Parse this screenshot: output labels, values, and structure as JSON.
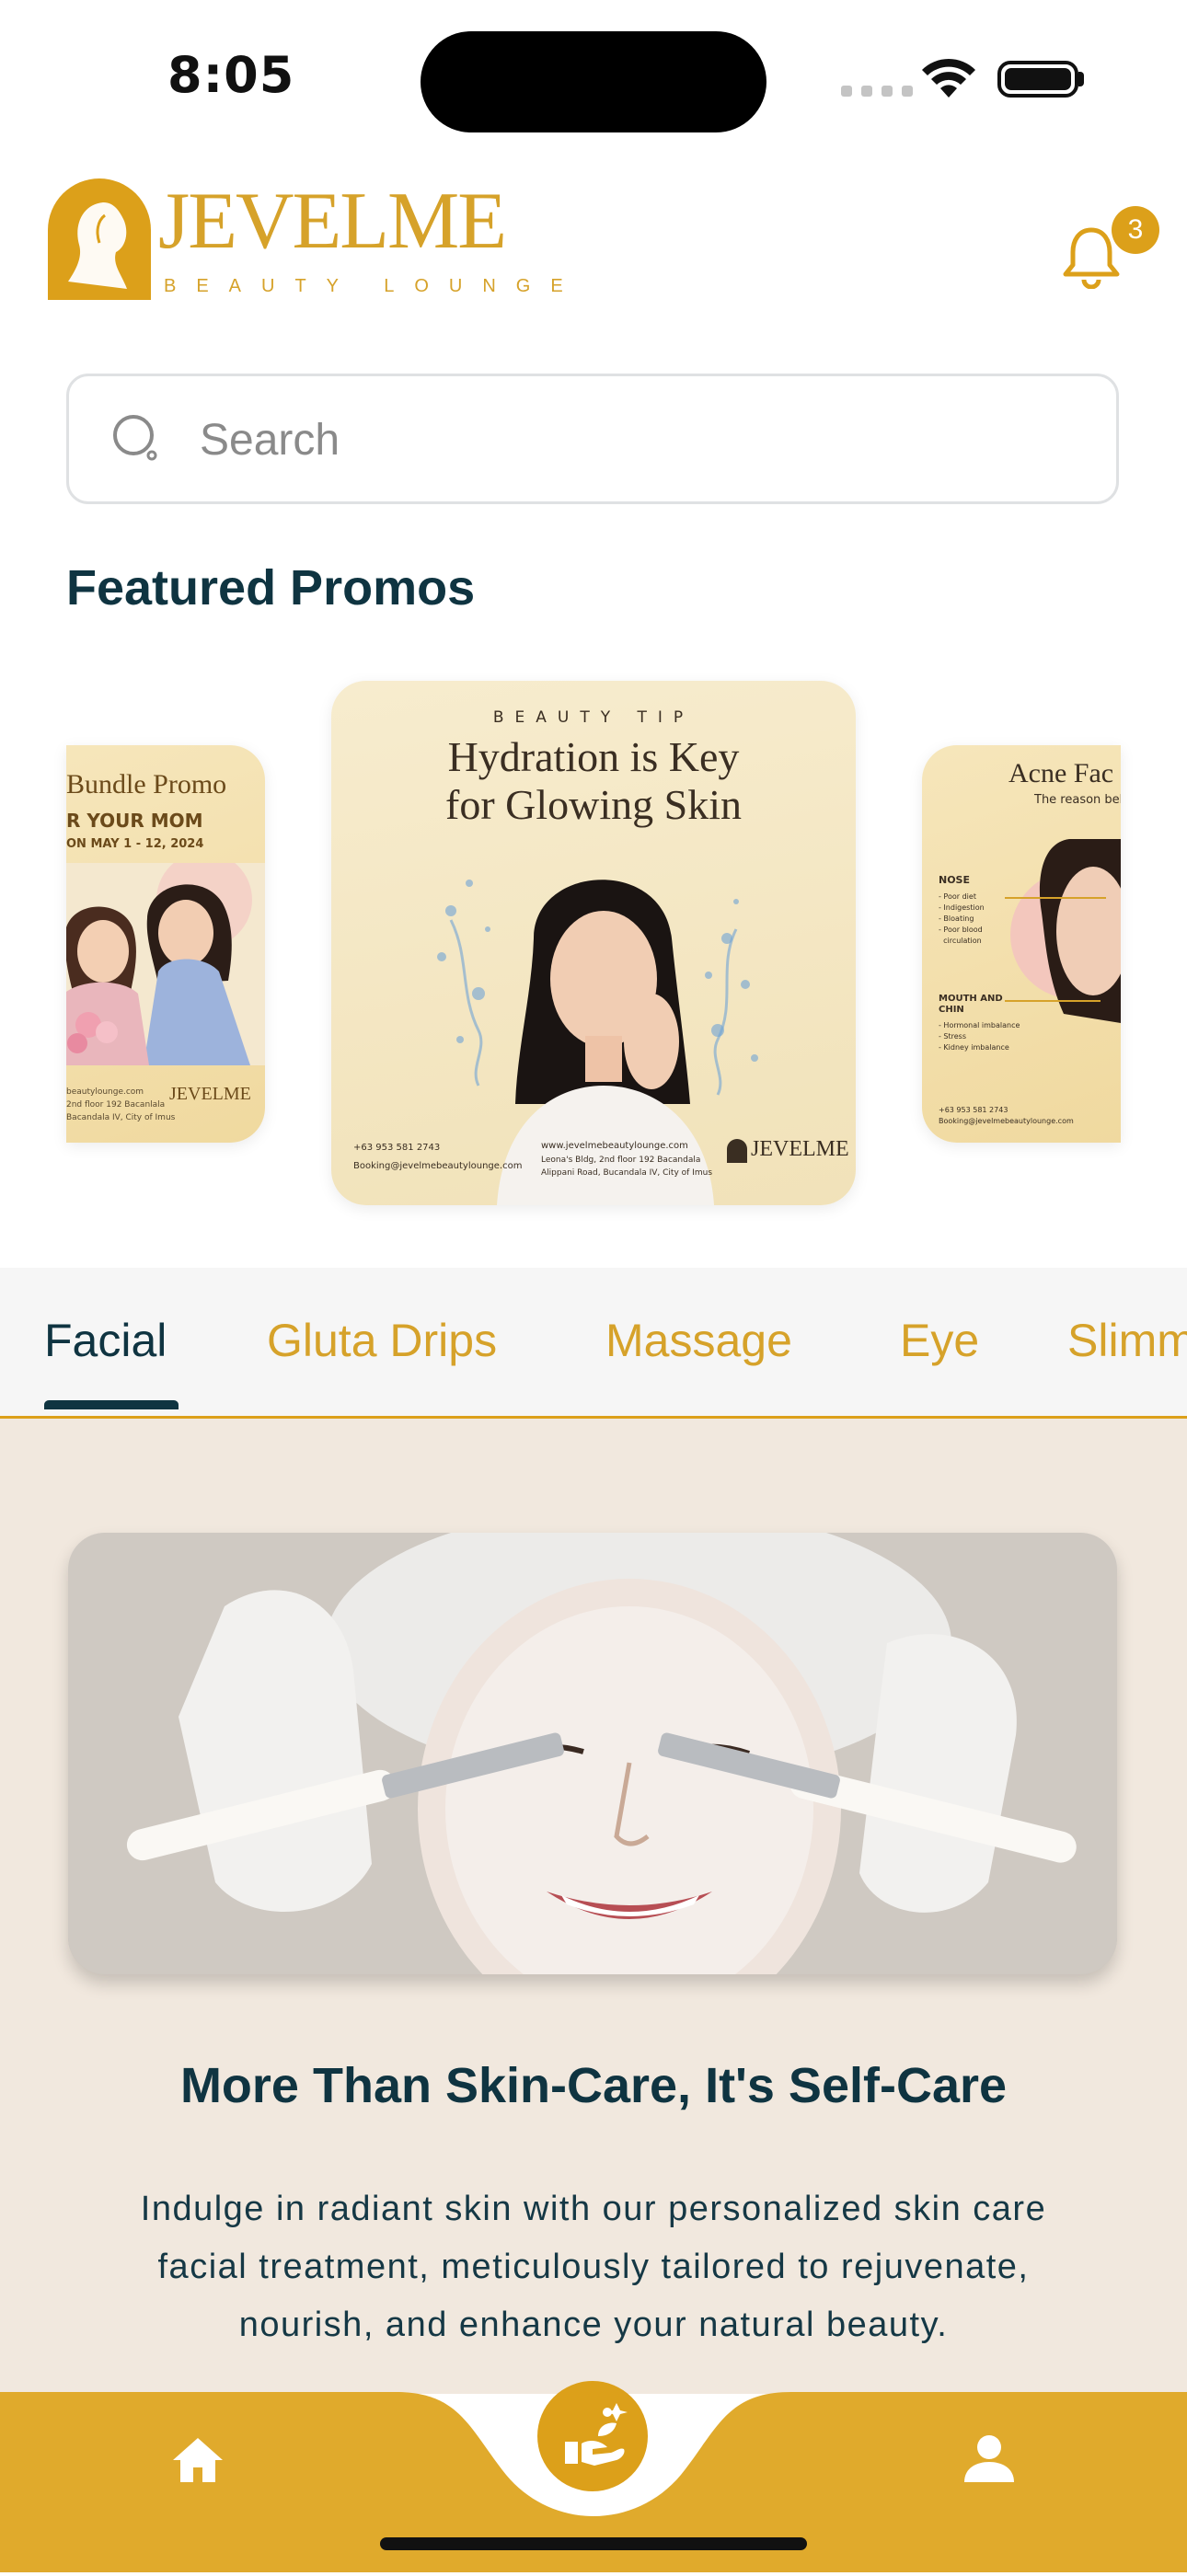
{
  "status_bar": {
    "time": "8:05"
  },
  "header": {
    "logo_text": "JEVELME",
    "logo_subtext": "BEAUTY LOUNGE",
    "notification_count": "3"
  },
  "search": {
    "placeholder": "Search"
  },
  "featured": {
    "title": "Featured Promos",
    "promos": [
      {
        "title": "Bundle Promo",
        "subtitle": "R YOUR MOM",
        "dates": "ON MAY 1 - 12, 2024",
        "footer_a": "beautylounge.com",
        "footer_b": "2nd floor 192 Bacanlala",
        "footer_c": "Bacandala IV, City of Imus",
        "brand": "JEVELME"
      },
      {
        "kicker": "BEAUTY TIP",
        "title_line1": "Hydration is Key",
        "title_line2": "for Glowing Skin",
        "phone": "+63 953 581 2743",
        "email": "Booking@jevelmebeautylounge.com",
        "website": "www.jevelmebeautylounge.com",
        "address1": "Leona's Bldg, 2nd floor 192 Bacandala",
        "address2": "Alippani Road, Bucandala IV, City of Imus",
        "brand": "JEVELME"
      },
      {
        "title": "Acne Fac",
        "subtitle": "The reason behin",
        "section1_title": "NOSE",
        "section1_items": [
          "- Poor diet",
          "- Indigestion",
          "- Bloating",
          "- Poor blood",
          "  circulation"
        ],
        "section2_title": "MOUTH AND CHIN",
        "section2_items": [
          "- Hormonal imbalance",
          "- Stress",
          "- Kidney imbalance"
        ],
        "phone": "+63 953 581 2743",
        "email": "Booking@jevelmebeautylounge.com"
      }
    ]
  },
  "tabs": {
    "items": [
      "Facial",
      "Gluta Drips",
      "Massage",
      "Eye",
      "Slimm"
    ],
    "active": "Facial"
  },
  "content": {
    "title": "More Than Skin-Care, It's Self-Care",
    "description": "Indulge in radiant skin with our personalized skin care facial treatment, meticulously tailored to rejuvenate, nourish, and enhance your natural beauty."
  },
  "nav": {
    "home_icon": "home-icon",
    "center_icon": "spa-service-icon",
    "profile_icon": "profile-icon"
  },
  "colors": {
    "primary_navy": "#0f3441",
    "accent_gold": "#dca01a",
    "content_bg": "#f1e8de"
  }
}
